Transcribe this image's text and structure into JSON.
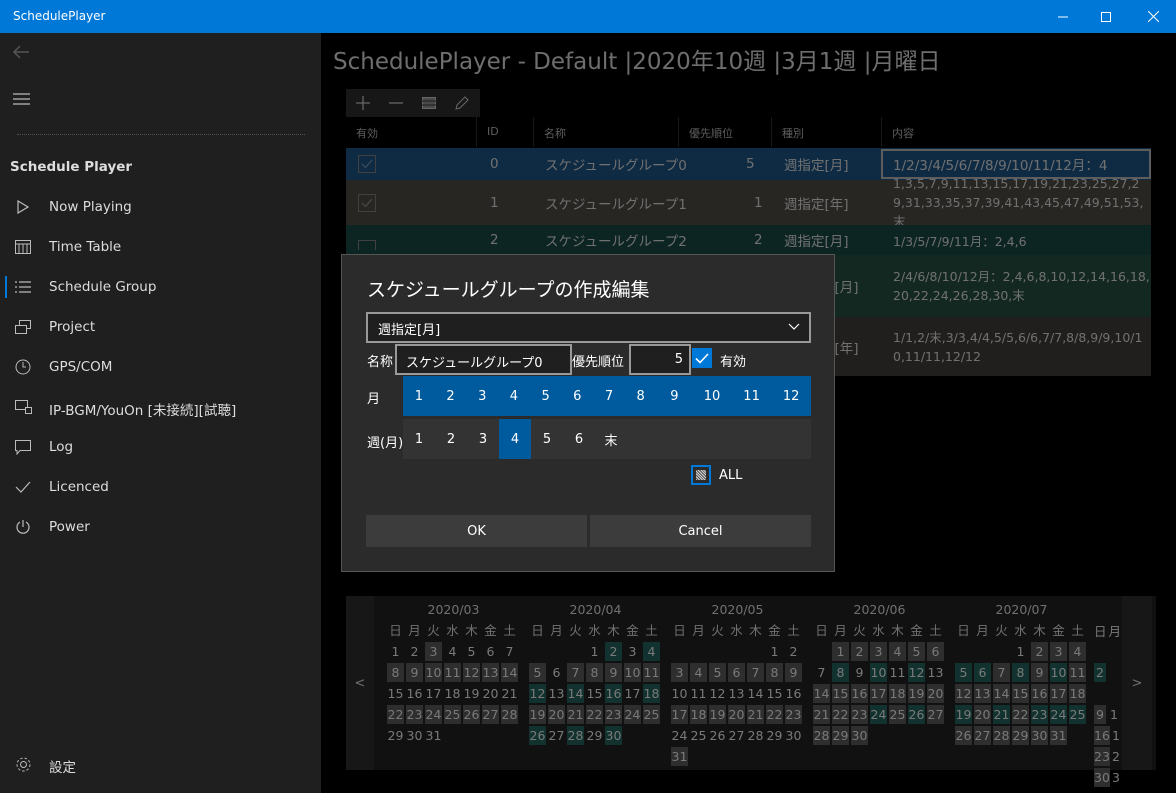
{
  "window": {
    "title": "SchedulePlayer"
  },
  "colors": {
    "accent": "#0078d7",
    "selected": "#005a9e",
    "teal": "#1f5b56"
  },
  "sidebar": {
    "app_name": "Schedule Player",
    "items": [
      {
        "label": "Now Playing",
        "icon": "play-icon"
      },
      {
        "label": "Time Table",
        "icon": "calendar-icon"
      },
      {
        "label": "Schedule Group",
        "icon": "list-icon"
      },
      {
        "label": "Project",
        "icon": "project-icon"
      },
      {
        "label": "GPS/COM",
        "icon": "clock-icon"
      },
      {
        "label": "IP-BGM/YouOn [未接続][試聴]",
        "icon": "network-icon"
      },
      {
        "label": "Log",
        "icon": "message-icon"
      },
      {
        "label": "Licenced",
        "icon": "check-icon"
      },
      {
        "label": "Power",
        "icon": "power-icon"
      }
    ],
    "settings_label": "設定"
  },
  "page": {
    "title": "SchedulePlayer - Default |2020年10週 |3月1週 |月曜日"
  },
  "grid": {
    "headers": [
      "有効",
      "ID",
      "名称",
      "優先順位",
      "種別",
      "内容"
    ],
    "rows": [
      {
        "enabled": true,
        "id": "0",
        "name": "スケジュールグループ0",
        "priority": "5",
        "type": "週指定[月]",
        "content": "1/2/3/4/5/6/7/8/9/10/11/12月：4"
      },
      {
        "enabled": true,
        "id": "1",
        "name": "スケジュールグループ1",
        "priority": "1",
        "type": "週指定[年]",
        "content": "1,3,5,7,9,11,13,15,17,19,21,23,25,27,29,31,33,35,37,39,41,43,45,47,49,51,53,末"
      },
      {
        "enabled": true,
        "id": "2",
        "name": "スケジュールグループ2",
        "priority": "2",
        "type": "週指定[月]",
        "content": "1/3/5/7/9/11月：2,4,6"
      },
      {
        "enabled": true,
        "id": "3",
        "name": "",
        "priority": "",
        "type": "定[月]",
        "content": "2/4/6/8/10/12月：2,4,6,8,10,12,14,16,18,20,22,24,26,28,30,末"
      },
      {
        "enabled": true,
        "id": "4",
        "name": "",
        "priority": "",
        "type": "定[年]",
        "content": "1/1,2/末,3/3,4/4,5/5,6/6,7/7,8/8,9/9,10/10,11/11,12/12"
      }
    ]
  },
  "calendar": {
    "prev": "<",
    "next": ">",
    "weekdays": [
      "日",
      "月",
      "火",
      "水",
      "木",
      "金",
      "土"
    ],
    "months": [
      {
        "title": "2020/03",
        "weeks": [
          [
            "1:",
            "2:",
            "3:g",
            "4:",
            "5:",
            "6:",
            "7:"
          ],
          [
            "8:g",
            "9:g",
            "10:g",
            "11:g",
            "12:g",
            "13:g",
            "14:g"
          ],
          [
            "15:",
            "16:",
            "17:",
            "18:",
            "19:",
            "20:",
            "21:"
          ],
          [
            "22:g",
            "23:g",
            "24:g",
            "25:g",
            "26:g",
            "27:g",
            "28:g"
          ],
          [
            "29:",
            "30:",
            "31:",
            "",
            "",
            "",
            ""
          ]
        ]
      },
      {
        "title": "2020/04",
        "weeks": [
          [
            "",
            "",
            "",
            "1:",
            "2:t",
            "3:",
            "4:t"
          ],
          [
            "5:g",
            "6:",
            "7:g",
            "8:g",
            "9:g",
            "10:g",
            "11:g"
          ],
          [
            "12:t",
            "13:",
            "14:t",
            "15:",
            "16:t",
            "17:",
            "18:t"
          ],
          [
            "19:g",
            "20:g",
            "21:g",
            "22:g",
            "23:g",
            "24:g",
            "25:g"
          ],
          [
            "26:t",
            "27:",
            "28:t",
            "29:",
            "30:t",
            "",
            ""
          ]
        ]
      },
      {
        "title": "2020/05",
        "weeks": [
          [
            "",
            "",
            "",
            "",
            "",
            "1:",
            "2:"
          ],
          [
            "3:g",
            "4:g",
            "5:g",
            "6:g",
            "7:g",
            "8:g",
            "9:g"
          ],
          [
            "10:",
            "11:",
            "12:",
            "13:",
            "14:",
            "15:",
            "16:"
          ],
          [
            "17:g",
            "18:g",
            "19:g",
            "20:g",
            "21:g",
            "22:g",
            "23:g"
          ],
          [
            "24:",
            "25:",
            "26:",
            "27:",
            "28:",
            "29:",
            "30:"
          ],
          [
            "31:g",
            "",
            "",
            "",
            "",
            "",
            ""
          ]
        ]
      },
      {
        "title": "2020/06",
        "weeks": [
          [
            "",
            "1:g",
            "2:g",
            "3:g",
            "4:g",
            "5:g",
            "6:g"
          ],
          [
            "7:",
            "8:t",
            "9:",
            "10:t",
            "11:",
            "12:t",
            "13:"
          ],
          [
            "14:g",
            "15:g",
            "16:g",
            "17:g",
            "18:g",
            "19:g",
            "20:g"
          ],
          [
            "21:g",
            "22:g",
            "23:g",
            "24:t",
            "25:g",
            "26:t",
            "27:g"
          ],
          [
            "28:g",
            "29:g",
            "30:g",
            "",
            "",
            "",
            ""
          ]
        ]
      },
      {
        "title": "2020/07",
        "weeks": [
          [
            "",
            "",
            "",
            "1:",
            "2:g",
            "3:g",
            "4:g"
          ],
          [
            "5:t",
            "6:t",
            "7:g",
            "8:t",
            "9:g",
            "10:t",
            "11:g"
          ],
          [
            "12:g",
            "13:g",
            "14:g",
            "15:g",
            "16:g",
            "17:g",
            "18:g"
          ],
          [
            "19:t",
            "20:g",
            "21:t",
            "22:g",
            "23:t",
            "24:t",
            "25:t"
          ],
          [
            "26:g",
            "27:g",
            "28:g",
            "29:g",
            "30:g",
            "31:g",
            ""
          ]
        ]
      },
      {
        "title": "",
        "weeks": [
          [
            "日",
            "月"
          ],
          [
            "",
            ""
          ],
          [
            "2:t",
            ""
          ],
          [
            "",
            ""
          ],
          [
            "9:g",
            "1"
          ],
          [
            "16:g",
            "1"
          ],
          [
            "23:g",
            "2"
          ],
          [
            "30:g",
            "3"
          ]
        ]
      }
    ]
  },
  "dialog": {
    "title": "スケジュールグループの作成編集",
    "type_value": "週指定[月]",
    "name_label": "名称",
    "name_value": "スケジュールグループ0",
    "priority_label": "優先順位",
    "priority_value": "5",
    "enabled_label": "有効",
    "enabled": true,
    "month_label": "月",
    "months": [
      "1",
      "2",
      "3",
      "4",
      "5",
      "6",
      "7",
      "8",
      "9",
      "10",
      "11",
      "12"
    ],
    "week_label": "週(月)",
    "weeks": [
      "1",
      "2",
      "3",
      "4",
      "5",
      "6",
      "末"
    ],
    "selected_week": "4",
    "all_label": "ALL",
    "ok_label": "OK",
    "cancel_label": "Cancel"
  }
}
